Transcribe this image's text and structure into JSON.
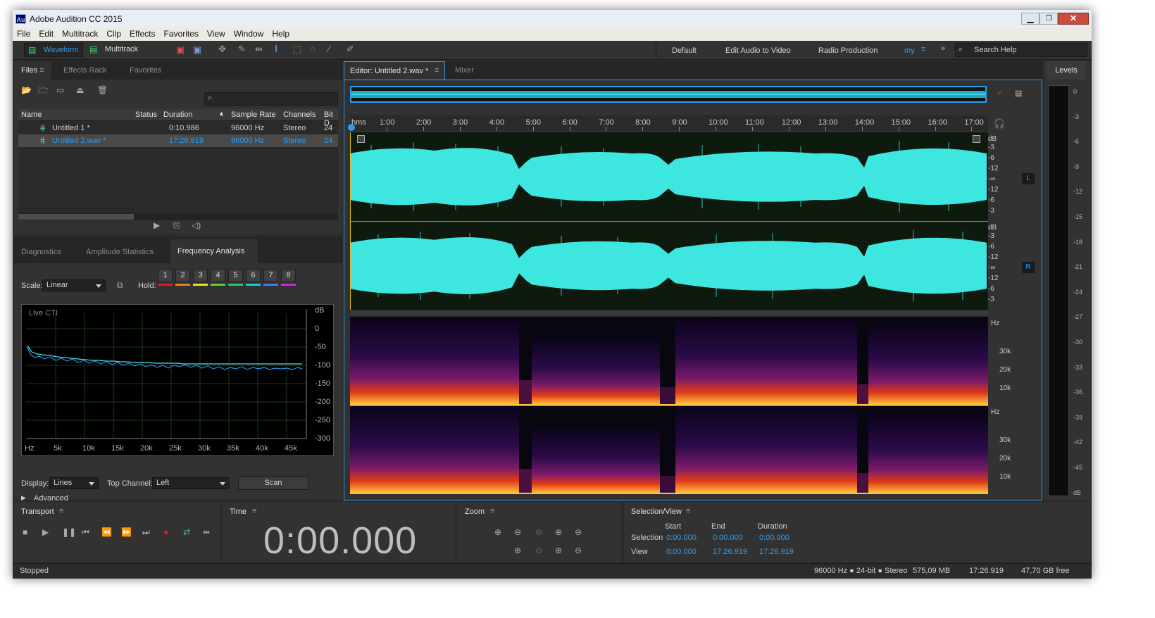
{
  "title_bar": {
    "app_icon": "Au",
    "title": "Adobe Audition CC 2015"
  },
  "menu": [
    "File",
    "Edit",
    "Multitrack",
    "Clip",
    "Effects",
    "Favorites",
    "View",
    "Window",
    "Help"
  ],
  "toolbar": {
    "waveform_label": "Waveform",
    "multitrack_label": "Multitrack",
    "workspaces": [
      "Default",
      "Edit Audio to Video",
      "Radio Production",
      "my"
    ],
    "search_placeholder": "Search Help"
  },
  "files_panel": {
    "tabs": [
      "Files",
      "Effects Rack",
      "Favorites"
    ],
    "columns": [
      "Name",
      "Status",
      "Duration",
      "Sample Rate",
      "Channels",
      "Bit D"
    ],
    "rows": [
      {
        "name": "Untitled 1 *",
        "status": "",
        "duration": "0:10.986",
        "sample_rate": "96000 Hz",
        "channels": "Stereo",
        "bit_depth": "24"
      },
      {
        "name": "Untitled 2.wav *",
        "status": "",
        "duration": "17:26.919",
        "sample_rate": "96000 Hz",
        "channels": "Stereo",
        "bit_depth": "24"
      }
    ]
  },
  "analysis_panel": {
    "tabs": [
      "Diagnostics",
      "Amplitude Statistics",
      "Frequency Analysis"
    ],
    "scale_label": "Scale:",
    "scale_value": "Linear",
    "hold_label": "Hold:",
    "hold_buttons": [
      "1",
      "2",
      "3",
      "4",
      "5",
      "6",
      "7",
      "8"
    ],
    "hold_colors": [
      "#e01b1b",
      "#e8801c",
      "#e8e21c",
      "#5fd01f",
      "#1fc77a",
      "#1fc7e2",
      "#3b7df0",
      "#d81fe0"
    ],
    "graph_label": "Live CTI",
    "db_unit": "dB",
    "db_ticks": [
      "0",
      "-50",
      "-100",
      "-150",
      "-200",
      "-250",
      "-300"
    ],
    "hz_ticks": [
      "Hz",
      "5k",
      "10k",
      "15k",
      "20k",
      "25k",
      "30k",
      "35k",
      "40k",
      "45k"
    ],
    "display_label": "Display:",
    "display_value": "Lines",
    "top_channel_label": "Top Channel:",
    "top_channel_value": "Left",
    "scan_label": "Scan",
    "advanced_label": "Advanced"
  },
  "editor": {
    "tab_label": "Editor: Untitled 2.wav *",
    "mixer_label": "Mixer",
    "ruler_unit": "hms",
    "ruler_ticks": [
      "1:00",
      "2:00",
      "3:00",
      "4:00",
      "5:00",
      "6:00",
      "7:00",
      "8:00",
      "9:00",
      "10:00",
      "11:00",
      "12:00",
      "13:00",
      "14:00",
      "15:00",
      "16:00",
      "17:00"
    ],
    "amp_unit": "dB",
    "amp_ticks": [
      "-3",
      "-6",
      "-12",
      "-∞",
      "-12",
      "-6",
      "-3"
    ],
    "channel_left": "L",
    "channel_right": "R",
    "spec_unit": "Hz",
    "spec_ticks": [
      "30k",
      "20k",
      "10k"
    ],
    "waveform_color": "#3ee6e0"
  },
  "levels": {
    "title": "Levels",
    "ticks": [
      "0",
      "-3",
      "-6",
      "-9",
      "-12",
      "-15",
      "-18",
      "-21",
      "-24",
      "-27",
      "-30",
      "-33",
      "-36",
      "-39",
      "-42",
      "-45",
      "dB"
    ]
  },
  "transport": {
    "title": "Transport"
  },
  "time_panel": {
    "title": "Time",
    "value": "0:00.000"
  },
  "zoom_panel": {
    "title": "Zoom"
  },
  "selection_view": {
    "title": "Selection/View",
    "headers": [
      "Start",
      "End",
      "Duration"
    ],
    "selection_label": "Selection",
    "selection": [
      "0:00.000",
      "0:00.000",
      "0:00.000"
    ],
    "view_label": "View",
    "view": [
      "0:00.000",
      "17:26.919",
      "17:26.919"
    ]
  },
  "status_bar": {
    "state": "Stopped",
    "format": "96000 Hz ● 24-bit ● Stereo",
    "size": "575,09 MB",
    "duration": "17:26.919",
    "free": "47,70 GB free"
  }
}
